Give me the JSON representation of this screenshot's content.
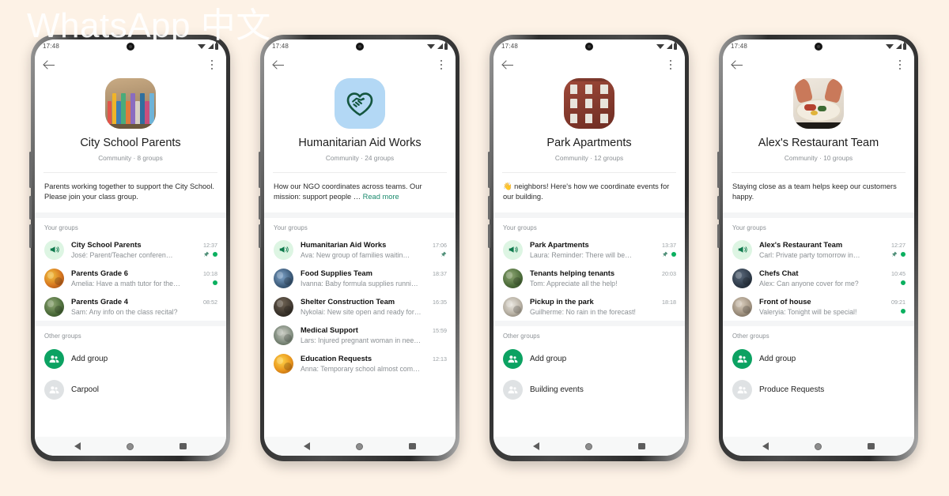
{
  "watermark": "WhatsApp 中文",
  "background_color": "#fdf2e6",
  "accent_color": "#0ca262",
  "unread_color": "#0bb05f",
  "link_color": "#1a8a6d",
  "status_bar": {
    "time": "17:48",
    "icons": [
      "wifi-icon",
      "signal-icon",
      "battery-icon"
    ]
  },
  "nav_bar": {
    "back": "nav-back-icon",
    "home": "nav-home-icon",
    "recents": "nav-recents-icon"
  },
  "app_bar": {
    "back": "back-arrow-icon",
    "menu": "kebab-menu-icon"
  },
  "labels": {
    "your_groups": "Your groups",
    "other_groups": "Other groups",
    "read_more": "Read more"
  },
  "phones": [
    {
      "community_name": "City School Parents",
      "community_sub": "Community · 8 groups",
      "description": "Parents working together to support the City School. Please join your class group.",
      "has_read_more": false,
      "avatar_style": "books",
      "your_groups": [
        {
          "name": "City School Parents",
          "snippet": "José: Parent/Teacher conferen…",
          "time": "12:37",
          "avatar": "announcement",
          "pinned": true,
          "unread": true
        },
        {
          "name": "Parents Grade 6",
          "snippet": "Amelia: Have a math tutor for the…",
          "time": "10:18",
          "avatar": "photo-g1",
          "pinned": false,
          "unread": true
        },
        {
          "name": "Parents Grade 4",
          "snippet": "Sam: Any info on the class recital?",
          "time": "08:52",
          "avatar": "photo-g6",
          "pinned": false,
          "unread": false
        }
      ],
      "other_groups": [
        {
          "name": "Add group",
          "avatar": "add-group"
        },
        {
          "name": "Carpool",
          "avatar": "ghost-group"
        }
      ]
    },
    {
      "community_name": "Humanitarian Aid Works",
      "community_sub": "Community · 24 groups",
      "description": "How our NGO coordinates across teams. Our mission: support people …",
      "has_read_more": true,
      "avatar_style": "heart-handshake",
      "your_groups": [
        {
          "name": "Humanitarian Aid Works",
          "snippet": "Ava: New group of families waitin…",
          "time": "17:06",
          "avatar": "announcement",
          "pinned": true,
          "unread": false
        },
        {
          "name": "Food Supplies Team",
          "snippet": "Ivanna: Baby formula supplies running …",
          "time": "18:37",
          "avatar": "photo-g2",
          "pinned": false,
          "unread": false
        },
        {
          "name": "Shelter Construction Team",
          "snippet": "Nykolai: New site open and ready for …",
          "time": "16:35",
          "avatar": "photo-g3",
          "pinned": false,
          "unread": false
        },
        {
          "name": "Medical Support",
          "snippet": "Lars: Injured pregnant woman in need…",
          "time": "15:59",
          "avatar": "photo-g4",
          "pinned": false,
          "unread": false
        },
        {
          "name": "Education Requests",
          "snippet": "Anna: Temporary school almost comp…",
          "time": "12:13",
          "avatar": "photo-g5",
          "pinned": false,
          "unread": false
        }
      ],
      "other_groups": []
    },
    {
      "community_name": "Park Apartments",
      "community_sub": "Community · 12 groups",
      "description": "👋 neighbors! Here's how we coordinate events for our building.",
      "has_read_more": false,
      "avatar_style": "building",
      "your_groups": [
        {
          "name": "Park Apartments",
          "snippet": "Laura: Reminder: There will be…",
          "time": "13:37",
          "avatar": "announcement",
          "pinned": true,
          "unread": true
        },
        {
          "name": "Tenants helping tenants",
          "snippet": "Tom: Appreciate all the help!",
          "time": "20:03",
          "avatar": "photo-g6",
          "pinned": false,
          "unread": false
        },
        {
          "name": "Pickup in the park",
          "snippet": "Guilherme: No rain in the forecast!",
          "time": "18:18",
          "avatar": "photo-g7",
          "pinned": false,
          "unread": false
        }
      ],
      "other_groups": [
        {
          "name": "Add group",
          "avatar": "add-group"
        },
        {
          "name": "Building events",
          "avatar": "ghost-group"
        }
      ]
    },
    {
      "community_name": "Alex's Restaurant Team",
      "community_sub": "Community · 10 groups",
      "description": "Staying close as a team helps keep our customers happy.",
      "has_read_more": false,
      "avatar_style": "food",
      "your_groups": [
        {
          "name": "Alex's Restaurant Team",
          "snippet": "Carl: Private party tomorrow in…",
          "time": "12:27",
          "avatar": "announcement",
          "pinned": true,
          "unread": true
        },
        {
          "name": "Chefs Chat",
          "snippet": "Alex: Can anyone cover for me?",
          "time": "10:45",
          "avatar": "photo-g8",
          "pinned": false,
          "unread": true
        },
        {
          "name": "Front of house",
          "snippet": "Valeryia: Tonight will be special!",
          "time": "09:21",
          "avatar": "photo-g9",
          "pinned": false,
          "unread": true
        }
      ],
      "other_groups": [
        {
          "name": "Add group",
          "avatar": "add-group"
        },
        {
          "name": "Produce Requests",
          "avatar": "ghost-group"
        }
      ]
    }
  ]
}
